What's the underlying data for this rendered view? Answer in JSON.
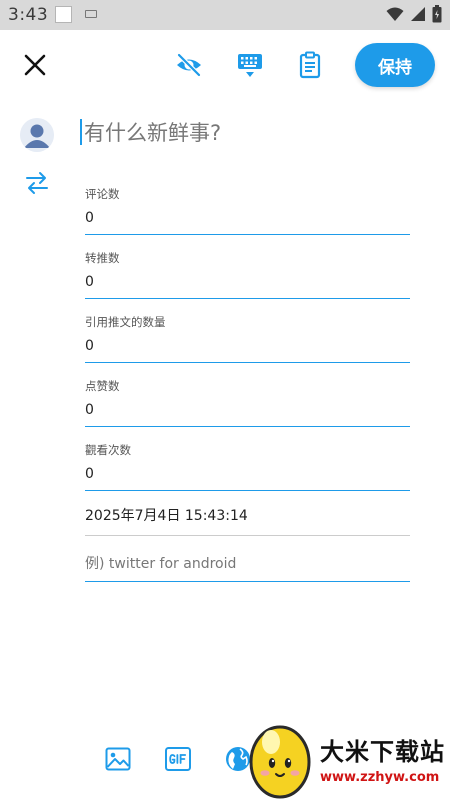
{
  "status_bar": {
    "time": "3:43",
    "icons": [
      "white-square-icon",
      "keyboard-icon",
      "wifi-icon",
      "signal-icon",
      "battery-icon"
    ]
  },
  "toolbar": {
    "icons": [
      "close-icon",
      "eye-off-icon",
      "keyboard-icon",
      "clipboard-icon"
    ],
    "save_label": "保持",
    "accent_color": "#1e9be9"
  },
  "composer": {
    "placeholder": "有什么新鲜事?",
    "avatar_icon": "person-avatar-icon",
    "swap_icon": "swap-arrows-icon"
  },
  "fields": [
    {
      "label": "评论数",
      "value": "0"
    },
    {
      "label": "转推数",
      "value": "0"
    },
    {
      "label": "引用推文的数量",
      "value": "0"
    },
    {
      "label": "点赞数",
      "value": "0"
    },
    {
      "label": "觀看次数",
      "value": "0"
    }
  ],
  "datetime": "2025年7月4日 15:43:14",
  "client": {
    "placeholder": "例) twitter for android"
  },
  "bottom_toolbar": {
    "icons": [
      "image-icon",
      "gif-icon",
      "globe-icon"
    ]
  },
  "watermark": {
    "title": "大米下载站",
    "url": "www.zzhyw.com"
  }
}
